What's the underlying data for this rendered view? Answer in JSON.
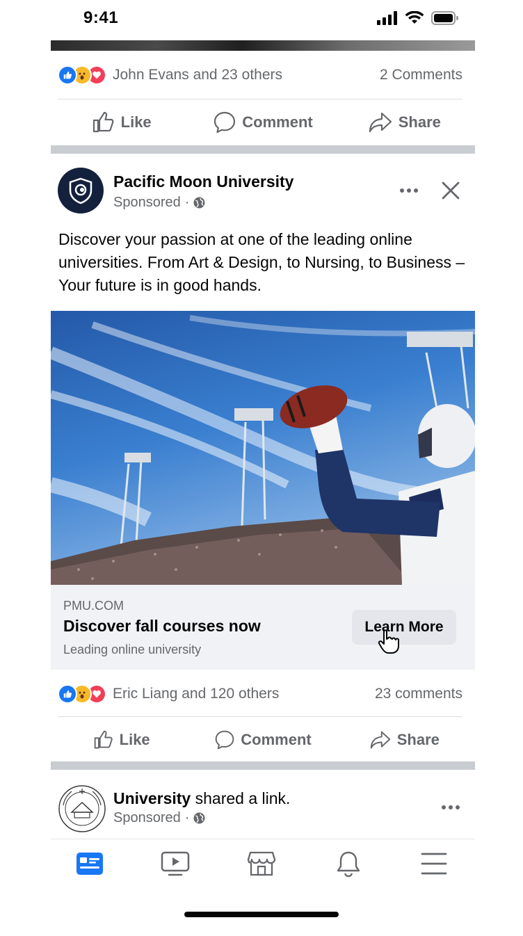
{
  "status_bar": {
    "time": "9:41"
  },
  "post_prev": {
    "reactions_text": "John Evans and 23 others",
    "comments_text": "2 Comments",
    "actions": {
      "like": "Like",
      "comment": "Comment",
      "share": "Share"
    }
  },
  "ad_post": {
    "page_name": "Pacific Moon University",
    "meta": "Sponsored",
    "text": "Discover your passion at one of the leading online universities. From Art & Design, to Nursing, to Business – Your future is in good hands.",
    "link": {
      "domain": "PMU.COM",
      "headline": "Discover fall courses now",
      "description": "Leading online university",
      "cta": "Learn More"
    },
    "reactions_text": "Eric Liang and 120 others",
    "comments_text": "23 comments",
    "actions": {
      "like": "Like",
      "comment": "Comment",
      "share": "Share"
    }
  },
  "shared_post": {
    "name": "University",
    "action_text": " shared a link.",
    "meta": "Sponsored"
  },
  "colors": {
    "like_blue": "#1877f2",
    "love_red": "#f33e58",
    "wow_yellow": "#f7b928",
    "secondary_text": "#65676b",
    "card_bg": "#f0f2f5"
  },
  "icons": {
    "nav": [
      "news-feed-icon",
      "watch-icon",
      "marketplace-icon",
      "notifications-icon",
      "menu-icon"
    ]
  }
}
